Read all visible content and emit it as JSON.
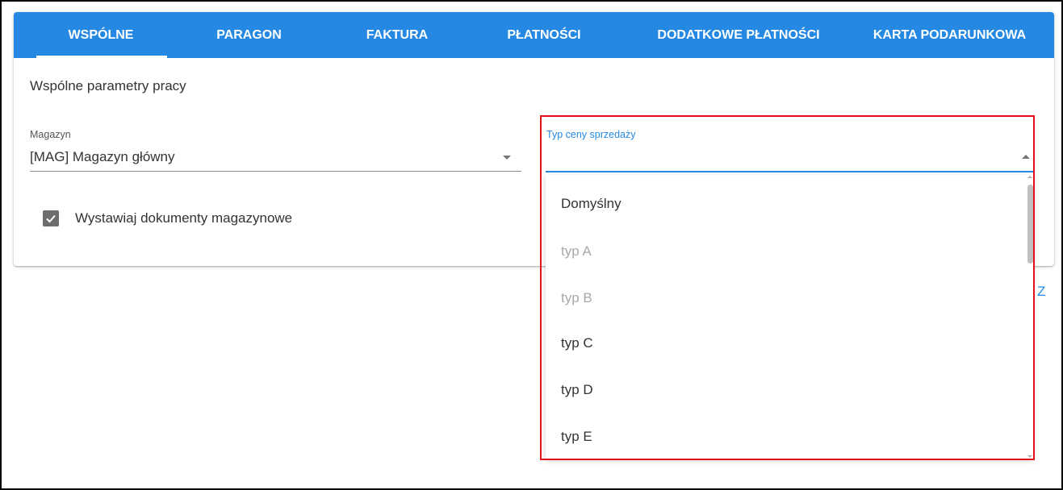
{
  "tabs": [
    {
      "label": "WSPÓLNE",
      "active": true
    },
    {
      "label": "PARAGON"
    },
    {
      "label": "FAKTURA"
    },
    {
      "label": "PŁATNOŚCI"
    },
    {
      "label": "DODATKOWE PŁATNOŚCI"
    },
    {
      "label": "KARTA PODARUNKOWA"
    }
  ],
  "section_title": "Wspólne parametry pracy",
  "magazyn": {
    "label": "Magazyn",
    "value": "[MAG] Magazyn główny"
  },
  "checkbox": {
    "label": "Wystawiaj dokumenty magazynowe",
    "checked": true
  },
  "typ_ceny": {
    "label": "Typ ceny sprzedaży",
    "value": "",
    "options": [
      {
        "label": "Domyślny",
        "disabled": false
      },
      {
        "label": "typ A",
        "disabled": true
      },
      {
        "label": "typ B",
        "disabled": true
      },
      {
        "label": "typ C",
        "disabled": false
      },
      {
        "label": "typ D",
        "disabled": false
      },
      {
        "label": "typ E",
        "disabled": false
      }
    ]
  },
  "partial_link_text": "Z",
  "colors": {
    "accent": "#2589e3",
    "highlight_border": "#e0121b",
    "disabled_text": "#a9a9a9"
  },
  "icons": [
    "checkmark-icon",
    "dropdown-arrow-down-icon",
    "dropdown-arrow-up-icon"
  ]
}
